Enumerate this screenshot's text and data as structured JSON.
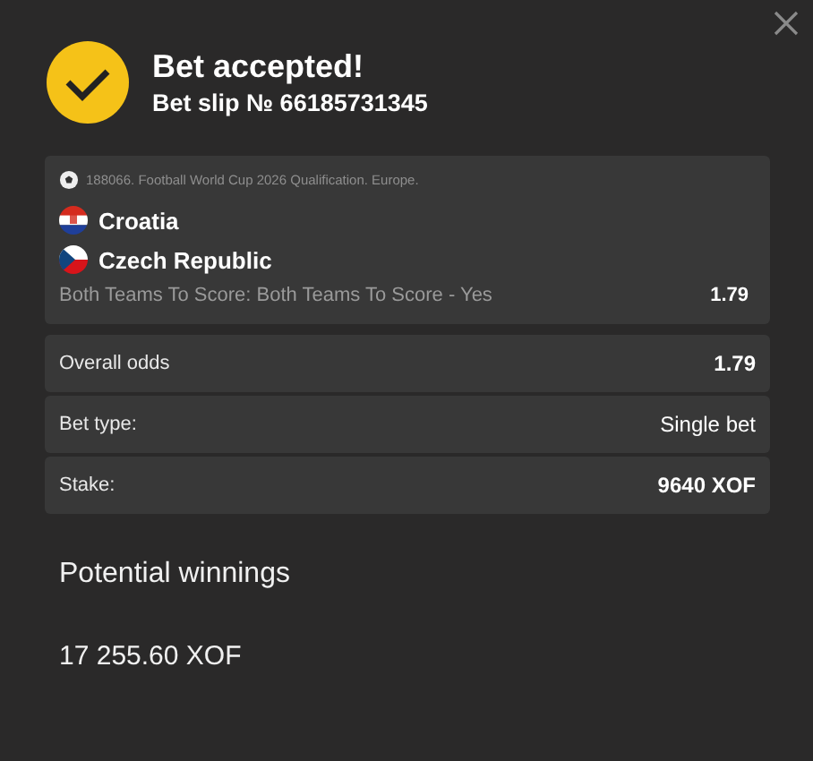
{
  "header": {
    "title": "Bet accepted!",
    "subtitle": "Bet slip № 66185731345"
  },
  "event": {
    "tournament": "188066. Football World Cup 2026 Qualification. Europe.",
    "teams": [
      {
        "name": "Croatia",
        "kind": "croatia"
      },
      {
        "name": "Czech Republic",
        "kind": "czech"
      }
    ],
    "market": "Both Teams To Score:  Both Teams To Score - Yes",
    "odds": "1.79"
  },
  "summary": [
    {
      "label": "Overall odds",
      "value": "1.79"
    },
    {
      "label": "Bet type:",
      "value": "Single bet"
    },
    {
      "label": "Stake:",
      "value": "9640 XOF"
    }
  ],
  "winnings": {
    "label": "Potential winnings",
    "value": "17 255.60 XOF"
  }
}
